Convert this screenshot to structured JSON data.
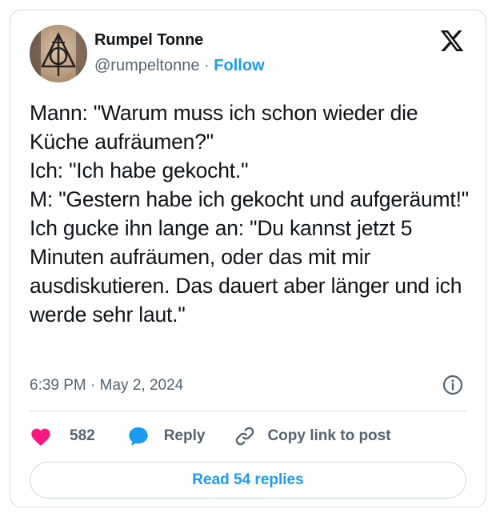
{
  "author": {
    "name": "Rumpel Tonne",
    "handle": "@rumpeltonne",
    "separator": "·",
    "follow_label": "Follow",
    "avatar_icon": "deathly-hallows-avatar"
  },
  "header": {
    "logo_icon": "x-logo-icon"
  },
  "post": {
    "text": "Mann: \"Warum muss ich schon wieder die Küche aufräumen?\"\nIch: \"Ich habe gekocht.\"\nM: \"Gestern habe ich gekocht und aufgeräumt!\"\nIch gucke ihn lange an: \"Du kannst jetzt 5 Minuten aufräumen, oder das mit mir ausdiskutieren. Das dauert aber länger und ich werde sehr laut.\"",
    "timestamp": "6:39 PM · May 2, 2024"
  },
  "actions": {
    "like_count": "582",
    "reply_label": "Reply",
    "copy_label": "Copy link to post"
  },
  "footer": {
    "read_replies_label": "Read 54 replies"
  },
  "colors": {
    "accent": "#1d9bf0",
    "like": "#f91880",
    "muted": "#536471",
    "border": "#cfd9de"
  }
}
